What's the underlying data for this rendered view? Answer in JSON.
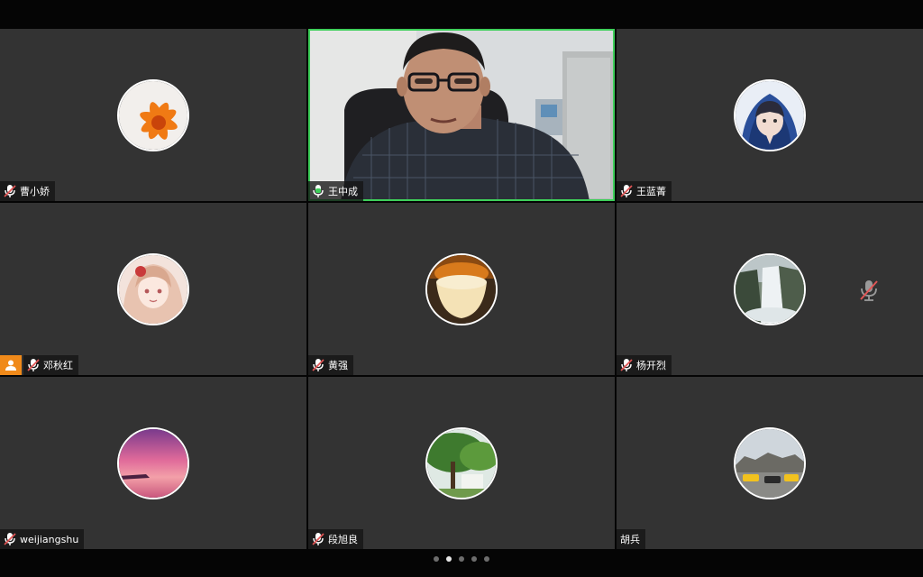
{
  "participants": [
    {
      "name": "曹小娇",
      "mic": "muted",
      "avatar": "orange-flower-avatar"
    },
    {
      "name": "王中成",
      "mic": "active",
      "avatar": "live-video-feed"
    },
    {
      "name": "王蓝菁",
      "mic": "muted",
      "avatar": "hooded-anime-girl-avatar"
    },
    {
      "name": "邓秋红",
      "mic": "muted",
      "avatar": "anime-girl-avatar",
      "host": true
    },
    {
      "name": "黄强",
      "mic": "muted",
      "avatar": "dessert-avatar"
    },
    {
      "name": "杨开烈",
      "mic": "muted",
      "avatar": "waterfall-avatar"
    },
    {
      "name": "weijiangshu",
      "mic": "muted",
      "avatar": "sunset-avatar"
    },
    {
      "name": "段旭良",
      "mic": "muted",
      "avatar": "tree-avatar"
    },
    {
      "name": "胡兵",
      "mic": "none",
      "avatar": "street-cars-avatar"
    }
  ],
  "pager": {
    "pages": 5,
    "current": 2
  },
  "colors": {
    "tile": "#333333",
    "active_border": "#3ecf5a",
    "muted_mic": "#e05555",
    "host_badge": "#f08a1a"
  }
}
